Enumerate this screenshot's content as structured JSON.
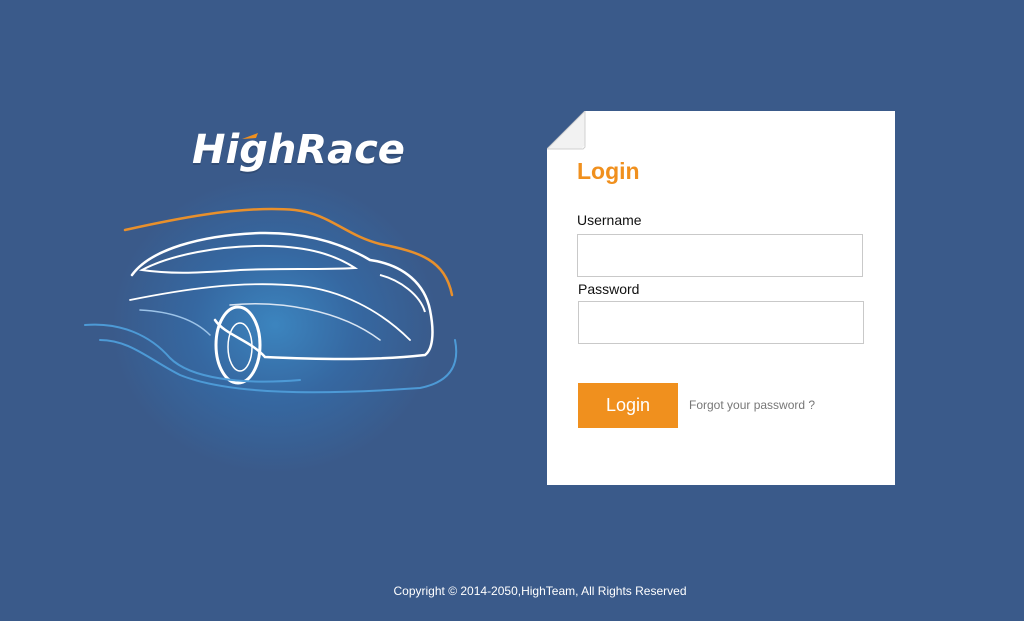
{
  "brand": {
    "logo_text": "HighRace",
    "accent_color": "#f0901e",
    "illustration": "sports-car-line-art"
  },
  "login": {
    "title": "Login",
    "username_label": "Username",
    "username_value": "",
    "password_label": "Password",
    "password_value": "",
    "submit_label": "Login",
    "forgot_label": "Forgot your password ?"
  },
  "footer": {
    "copyright": "Copyright © 2014-2050,HighTeam, All Rights Reserved"
  },
  "colors": {
    "background": "#3a5a8a",
    "card": "#ffffff",
    "accent": "#f0901e"
  }
}
